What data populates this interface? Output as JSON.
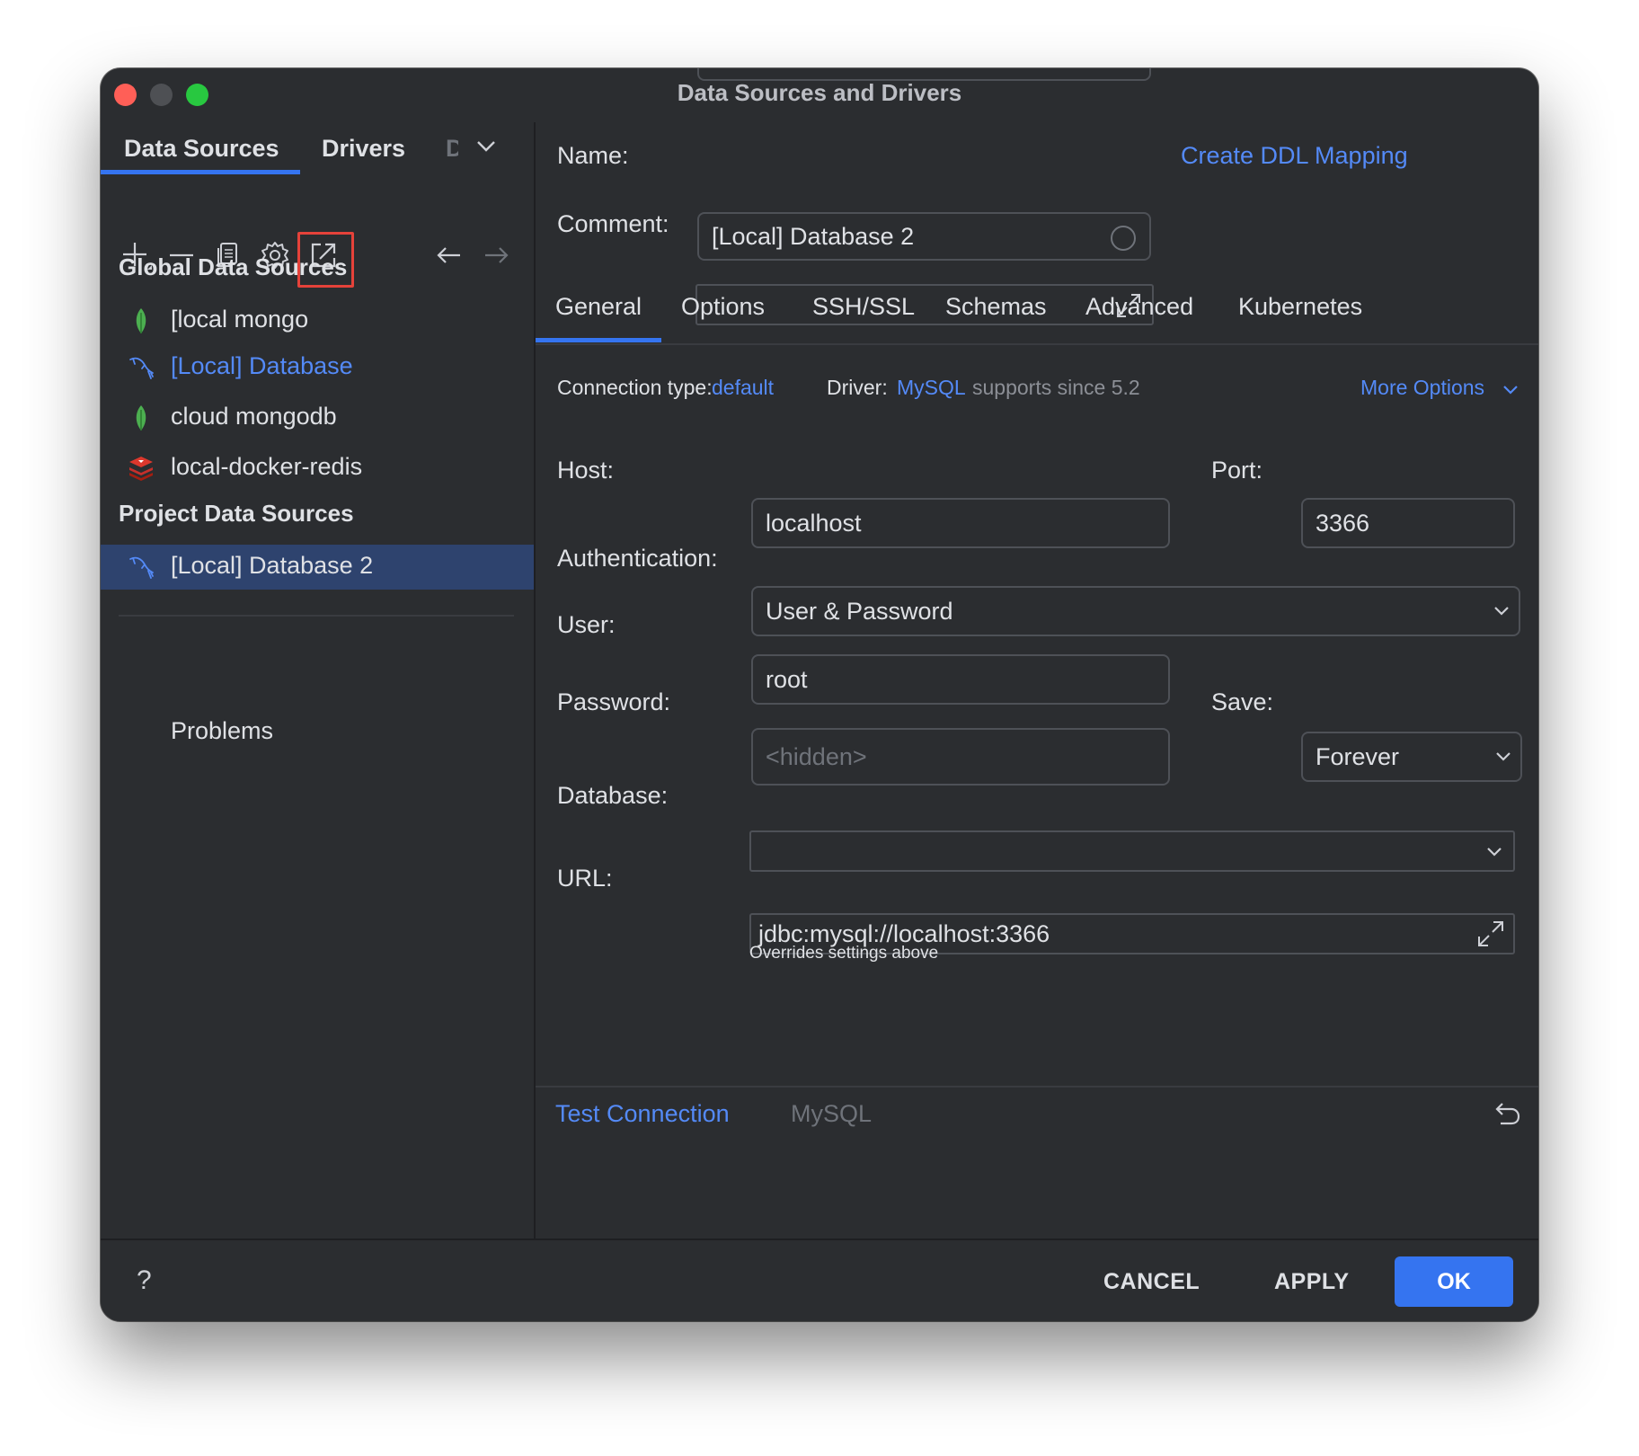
{
  "window": {
    "title": "Data Sources and Drivers"
  },
  "left_panel": {
    "tabs": [
      "Data Sources",
      "Drivers",
      "D"
    ],
    "sections": {
      "global": {
        "title": "Global Data Sources",
        "items": [
          {
            "label": "[local  mongo",
            "icon": "mongodb-leaf-icon"
          },
          {
            "label": "[Local] Database",
            "icon": "mysql-dolphin-icon"
          },
          {
            "label": "cloud mongodb",
            "icon": "mongodb-leaf-icon"
          },
          {
            "label": "local-docker-redis",
            "icon": "redis-icon"
          }
        ]
      },
      "project": {
        "title": "Project Data Sources",
        "items": [
          {
            "label": "[Local] Database 2",
            "icon": "mysql-dolphin-icon",
            "selected": true
          }
        ]
      }
    },
    "problems_label": "Problems"
  },
  "form": {
    "name_label": "Name:",
    "name_value": "[Local] Database 2",
    "create_ddl_link": "Create DDL Mapping",
    "comment_label": "Comment:",
    "comment_value": "",
    "tabs": [
      "General",
      "Options",
      "SSH/SSL",
      "Schemas",
      "Advanced",
      "Kubernetes"
    ],
    "active_tab": "General",
    "connection_type_label": "Connection type:",
    "connection_type_value": "default",
    "driver_label": "Driver:",
    "driver_value": "MySQL",
    "driver_note": "supports since 5.2",
    "more_options": "More Options",
    "host_label": "Host:",
    "host_value": "localhost",
    "port_label": "Port:",
    "port_value": "3366",
    "auth_label": "Authentication:",
    "auth_value": "User & Password",
    "user_label": "User:",
    "user_value": "root",
    "password_label": "Password:",
    "password_placeholder": "<hidden>",
    "save_label": "Save:",
    "save_value": "Forever",
    "database_label": "Database:",
    "database_value": "",
    "url_label": "URL:",
    "url_value": "jdbc:mysql://localhost:3366",
    "url_hint": "Overrides settings above",
    "test_connection": "Test Connection",
    "driver_footer": "MySQL"
  },
  "footer": {
    "help": "?",
    "cancel": "CANCEL",
    "apply": "APPLY",
    "ok": "OK"
  },
  "colors": {
    "background": "#2b2d30",
    "accent": "#3574f0",
    "link": "#548af7",
    "selection": "#2e436e",
    "highlight_box": "#e5423a"
  }
}
